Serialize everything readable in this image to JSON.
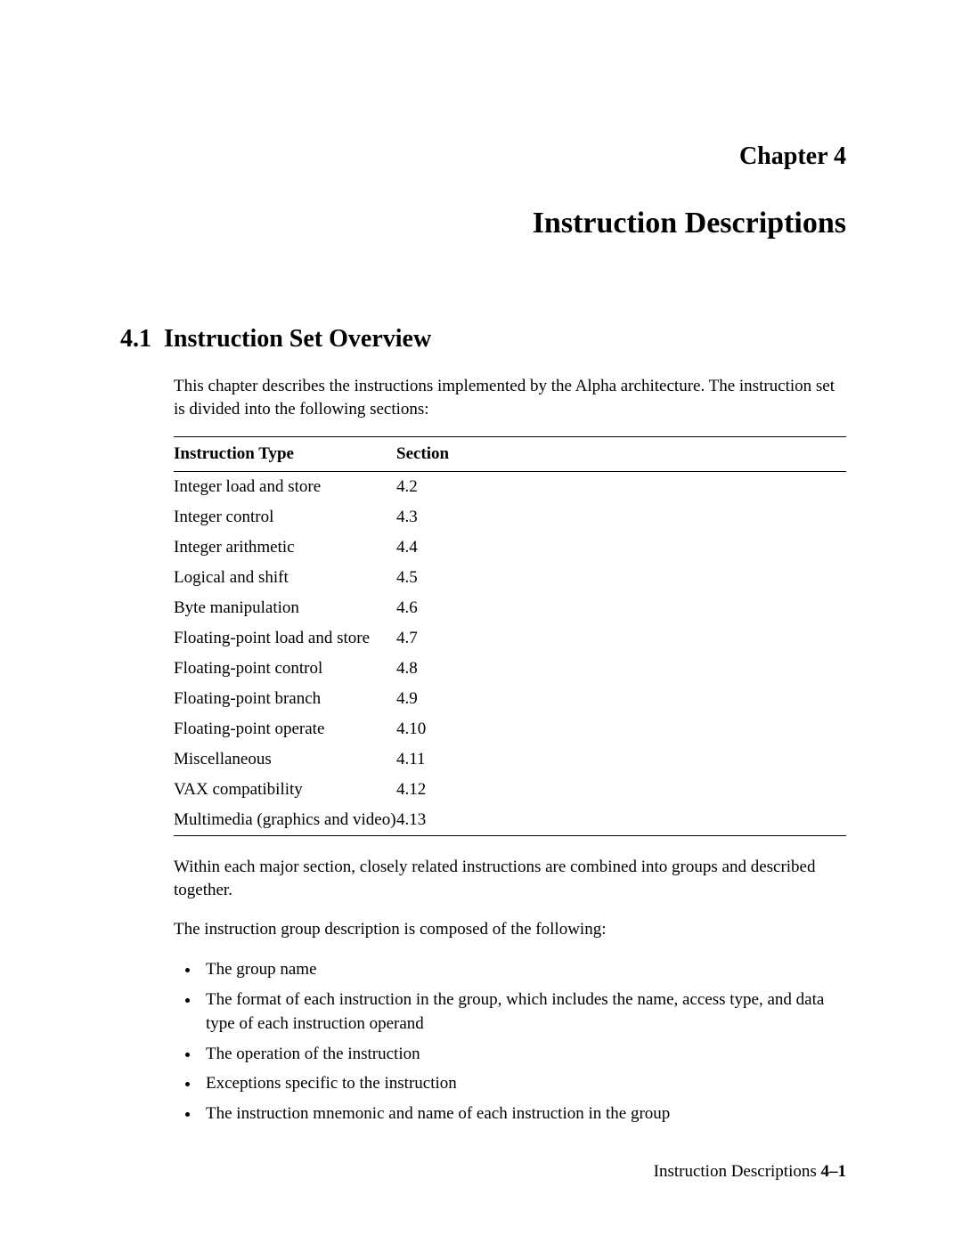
{
  "chapter": {
    "label": "Chapter 4",
    "title": "Instruction Descriptions"
  },
  "section": {
    "number": "4.1",
    "title": "Instruction Set Overview"
  },
  "intro": "This chapter describes the instructions implemented by the Alpha architecture. The instruction set is divided into the following sections:",
  "table": {
    "headers": {
      "type": "Instruction Type",
      "section": "Section"
    },
    "rows": [
      {
        "type": "Integer load and store",
        "section": "4.2"
      },
      {
        "type": "Integer control",
        "section": "4.3"
      },
      {
        "type": "Integer arithmetic",
        "section": "4.4"
      },
      {
        "type": "Logical and shift",
        "section": "4.5"
      },
      {
        "type": "Byte manipulation",
        "section": "4.6"
      },
      {
        "type": "Floating-point load and store",
        "section": "4.7"
      },
      {
        "type": "Floating-point control",
        "section": "4.8"
      },
      {
        "type": "Floating-point branch",
        "section": "4.9"
      },
      {
        "type": "Floating-point operate",
        "section": "4.10"
      },
      {
        "type": "Miscellaneous",
        "section": "4.11"
      },
      {
        "type": "VAX compatibility",
        "section": "4.12"
      },
      {
        "type": "Multimedia (graphics and video)",
        "section": "4.13"
      }
    ]
  },
  "para2": "Within each major section, closely related instructions are combined into groups and described together.",
  "para3": "The instruction group description is composed of the following:",
  "bullets": [
    "The group name",
    "The format of each instruction in the group, which includes the name, access type, and data type of each instruction operand",
    "The operation of the instruction",
    "Exceptions specific to the instruction",
    "The instruction mnemonic and name of each instruction in the group"
  ],
  "footer": {
    "text": "Instruction Descriptions",
    "page": "4–1"
  }
}
